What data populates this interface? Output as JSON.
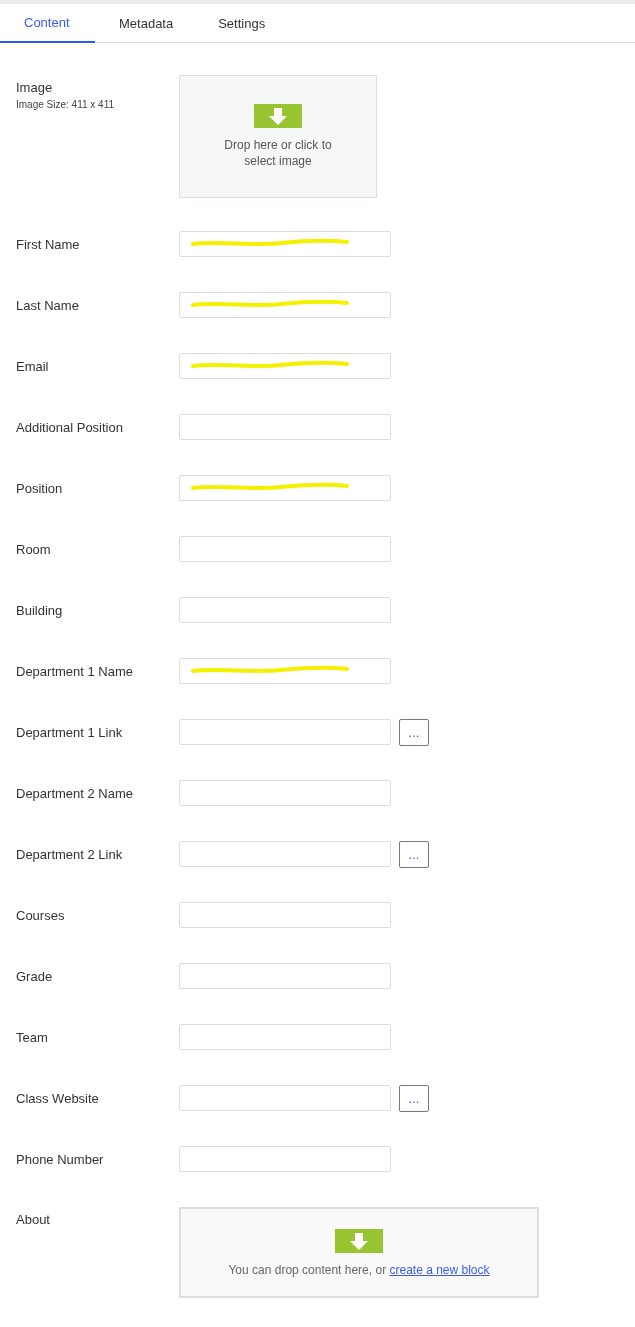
{
  "tabs": [
    {
      "label": "Content",
      "selected": true
    },
    {
      "label": "Metadata",
      "selected": false
    },
    {
      "label": "Settings",
      "selected": false
    }
  ],
  "image": {
    "label": "Image",
    "hint": "Image Size: 411 x 411",
    "drop_text": "Drop here or click to select image"
  },
  "fields": [
    {
      "kind": "text",
      "label": "First Name",
      "redacted": true
    },
    {
      "kind": "text",
      "label": "Last Name",
      "redacted": true
    },
    {
      "kind": "text",
      "label": "Email",
      "redacted": true
    },
    {
      "kind": "text",
      "label": "Additional Position",
      "redacted": false
    },
    {
      "kind": "text",
      "label": "Position",
      "redacted": true
    },
    {
      "kind": "text",
      "label": "Room",
      "redacted": false
    },
    {
      "kind": "text",
      "label": "Building",
      "redacted": false
    },
    {
      "kind": "text",
      "label": "Department 1 Name",
      "redacted": true
    },
    {
      "kind": "link",
      "label": "Department 1 Link",
      "redacted": false,
      "button": "..."
    },
    {
      "kind": "text",
      "label": "Department 2 Name",
      "redacted": false
    },
    {
      "kind": "link",
      "label": "Department 2 Link",
      "redacted": false,
      "button": "..."
    },
    {
      "kind": "text",
      "label": "Courses",
      "redacted": false
    },
    {
      "kind": "text",
      "label": "Grade",
      "redacted": false
    },
    {
      "kind": "text",
      "label": "Team",
      "redacted": false
    },
    {
      "kind": "link",
      "label": "Class Website",
      "redacted": false,
      "button": "..."
    },
    {
      "kind": "text",
      "label": "Phone Number",
      "redacted": false
    }
  ],
  "about": {
    "label": "About",
    "drop_text": "You can drop content here, or ",
    "link": "create a new block"
  }
}
